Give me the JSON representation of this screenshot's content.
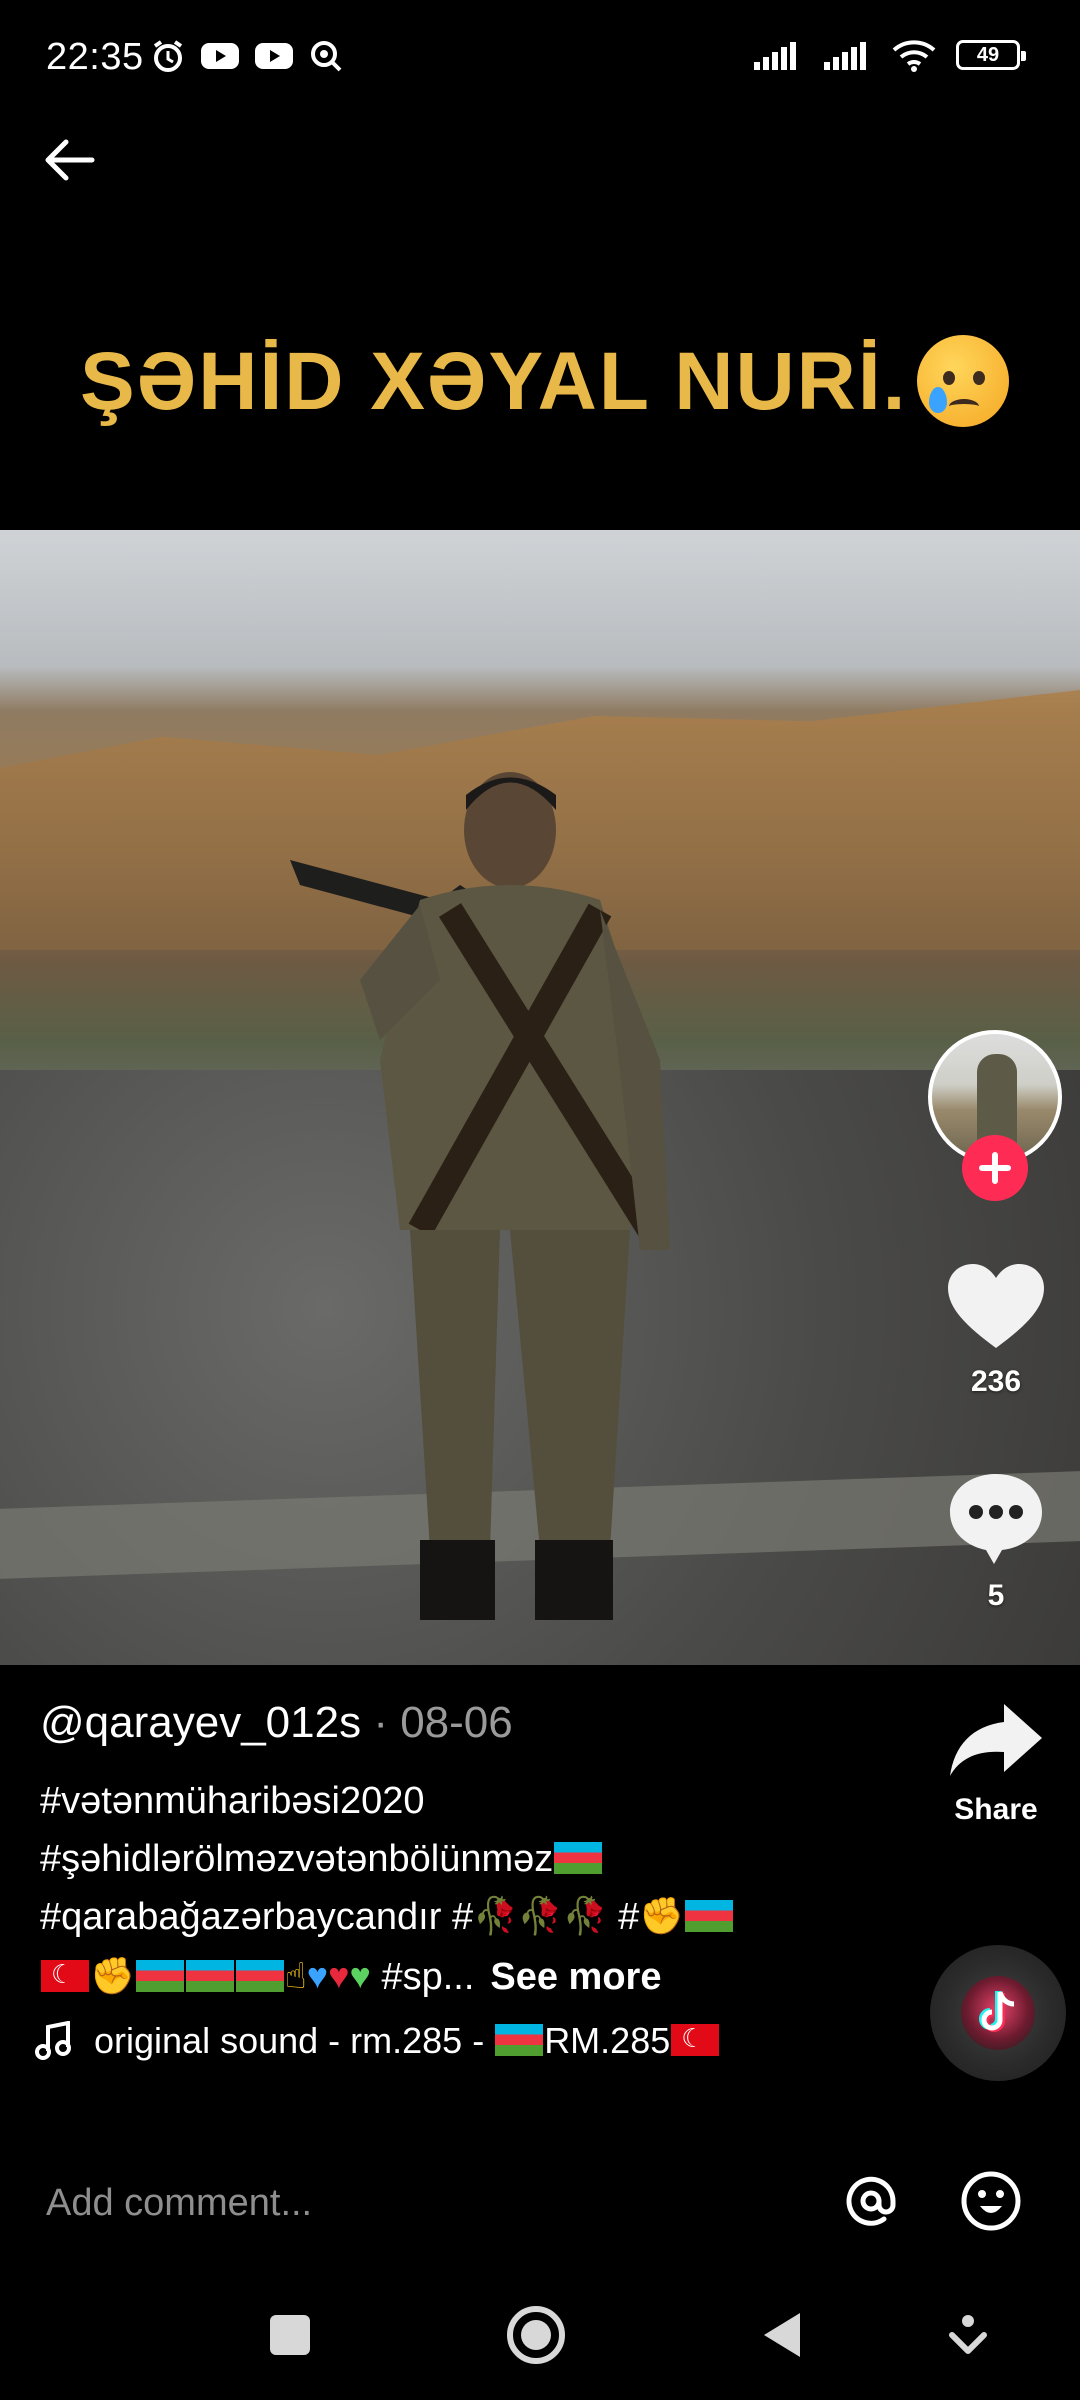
{
  "status_bar": {
    "time": "22:35",
    "battery": "49",
    "left_icons": [
      "alarm-icon",
      "youtube-icon",
      "youtube-icon",
      "search-notification-icon"
    ],
    "right_icons": [
      "signal-icon",
      "signal-icon",
      "wifi-icon",
      "battery-icon"
    ]
  },
  "video": {
    "overlay_title": "ŞƏHİD XƏYAL NURİ.",
    "overlay_emoji": "crying-face-icon"
  },
  "actions": {
    "like_count": "236",
    "comment_count": "5",
    "share_label": "Share"
  },
  "post": {
    "author": "@qarayev_012s",
    "date": "· 08-06",
    "caption_line1": "#vətənmüharibəsi2020",
    "caption_line2": "#şəhidlərölməzvətənbölünməz",
    "caption_line3a": "#qarabağazərbaycandır #",
    "caption_line3b": " #",
    "caption_line4_tail": "#sp...",
    "see_more": "See more"
  },
  "sound": {
    "text_a": "original sound - rm.285 - ",
    "text_b": "RM.285"
  },
  "comment": {
    "placeholder": "Add comment..."
  },
  "colors": {
    "accent": "#fe2c55",
    "title_gold": "#e8b948",
    "muted": "#9a9a9a"
  }
}
